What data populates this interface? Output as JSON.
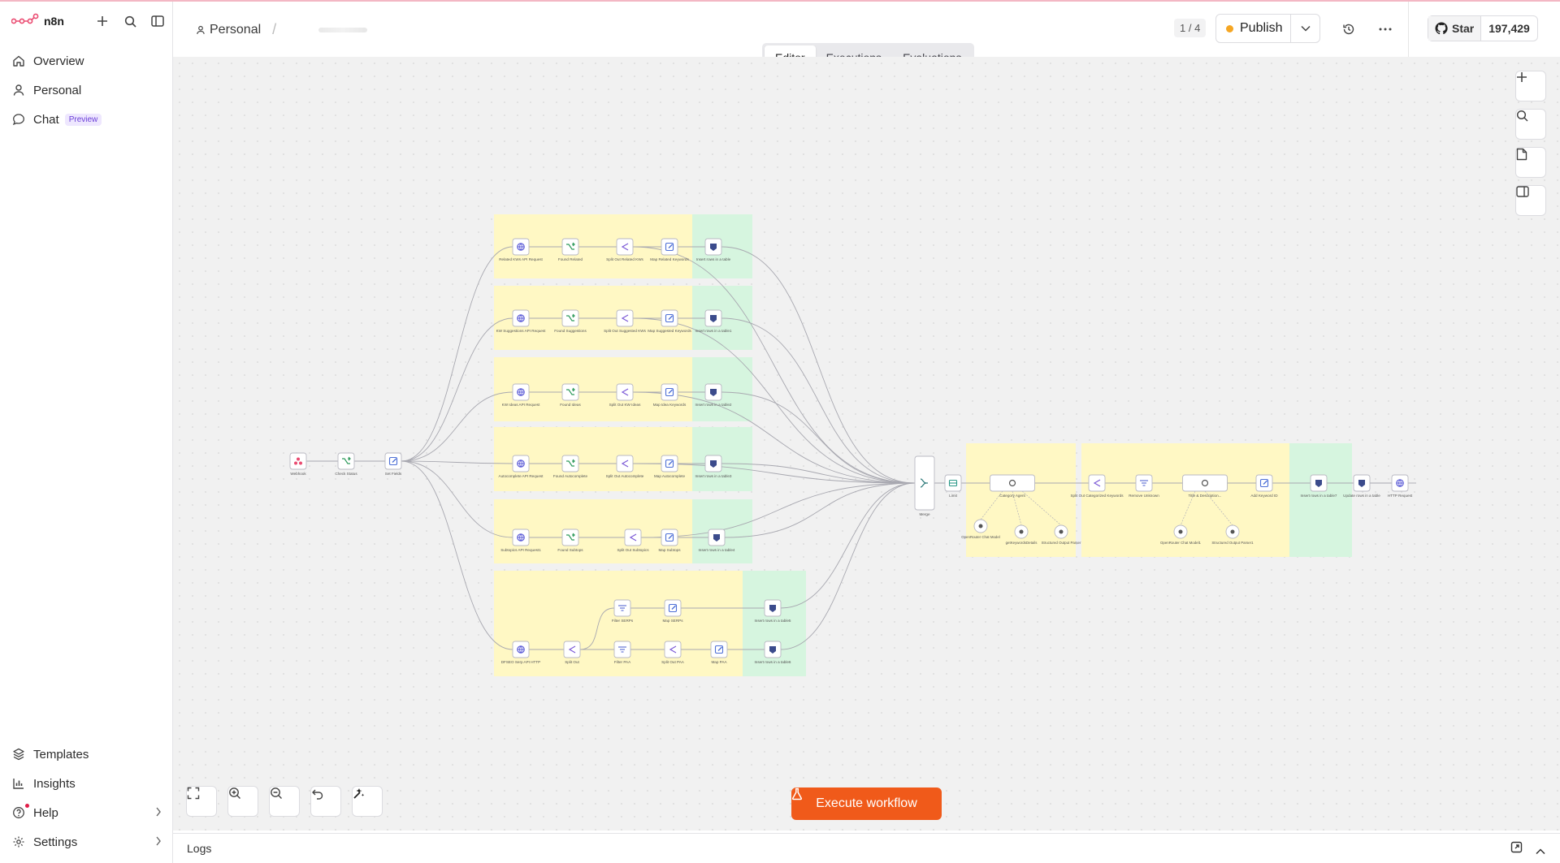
{
  "app": {
    "name": "n8n",
    "accent": "#f05a1a",
    "logo_color": "#ea4b71"
  },
  "sidebar": {
    "top_items": [
      {
        "label": "Overview",
        "icon": "home-icon"
      },
      {
        "label": "Personal",
        "icon": "user-icon"
      },
      {
        "label": "Chat",
        "icon": "chat-icon",
        "badge": "Preview"
      }
    ],
    "bottom_items": [
      {
        "label": "Templates",
        "icon": "templates-icon"
      },
      {
        "label": "Insights",
        "icon": "insights-icon"
      },
      {
        "label": "Help",
        "icon": "help-icon"
      },
      {
        "label": "Settings",
        "icon": "gear-icon"
      }
    ]
  },
  "header": {
    "breadcrumb_project": "Personal",
    "tabs": [
      "Editor",
      "Executions",
      "Evaluations"
    ],
    "active_tab": "Editor",
    "pager": "1 / 4",
    "publish_label": "Publish",
    "github_star_label": "Star",
    "github_star_count": "197,429"
  },
  "canvas": {
    "execute_label": "Execute workflow",
    "nodes": {
      "trigger": [
        "Webhook",
        "Check Status",
        "Set Fields"
      ],
      "row1": [
        "Related KWs API Request",
        "Found Related",
        "Split Out Related KWs",
        "Map Related Keywords",
        "Insert rows in a table"
      ],
      "row2": [
        "KW Suggestions API Request",
        "Found Suggestions",
        "Split Out Suggested KWs",
        "Map Suggested Keywords",
        "Insert rows in a table1"
      ],
      "row3": [
        "KW Ideas API Request",
        "Found Ideas",
        "Split Out KW Ideas",
        "Map Idea Keywords",
        "Insert rows in a table2"
      ],
      "row4": [
        "Autocomplete API Request",
        "Found Autocomplete",
        "Split Out Autocomplete",
        "Map Autocomplete",
        "Insert rows in a table3"
      ],
      "row5": [
        "Subtopics API Request1",
        "Found Subtops",
        "Split Out Subtopics",
        "Map Subtops",
        "Insert rows in a table4"
      ],
      "row6_top": [
        "Filter SERPs",
        "Map SERPs",
        "Insert rows in a table5"
      ],
      "row6_bottom": [
        "DFSEO Serp API HTTP",
        "Split Out",
        "Filter PAA",
        "Split Out PAA",
        "Map PAA",
        "Insert rows in a table6"
      ],
      "merge": "Merge",
      "right_chain": [
        "Limit",
        "Category Agent",
        "Split Out Categorized Keywords",
        "Remove Unknown",
        "Title & Description...",
        "Add Keyword ID",
        "Insert rows in a table7",
        "Update rows in a table",
        "HTTP Request"
      ],
      "sub_nodes": [
        "OpenRouter Chat Model",
        "getKeywordsDetails",
        "Structured Output Parser",
        "OpenRouter Chat Model1",
        "Structured Output Parser1"
      ]
    }
  },
  "logs": {
    "label": "Logs"
  }
}
